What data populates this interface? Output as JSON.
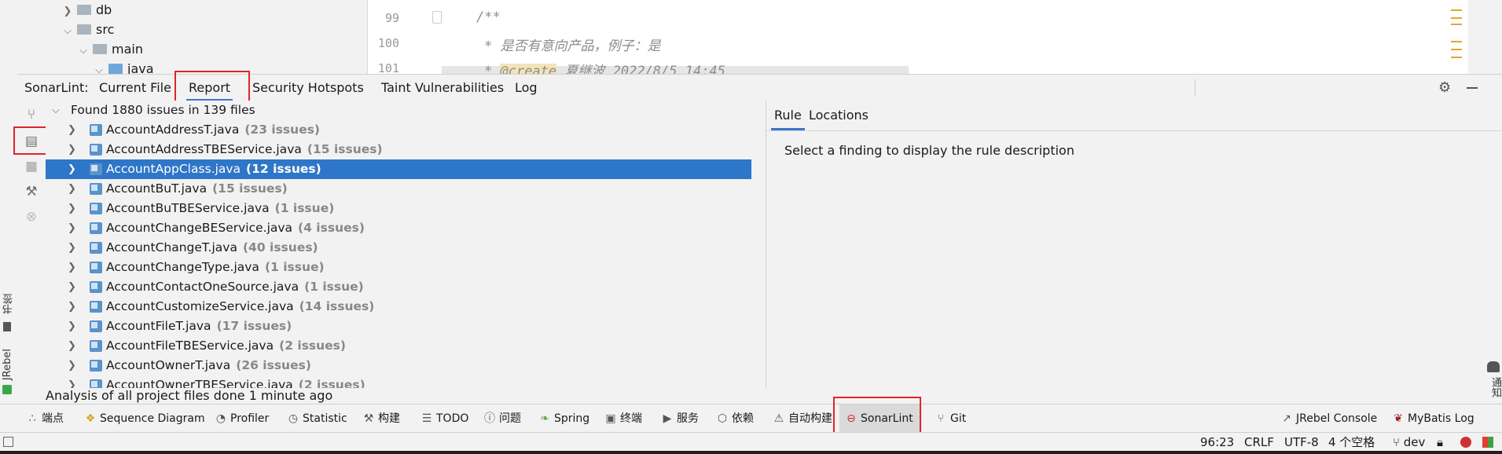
{
  "project_tree": [
    {
      "label": "db",
      "expanded": false
    },
    {
      "label": "src",
      "expanded": true
    },
    {
      "label": "main",
      "expanded": true
    },
    {
      "label": "java",
      "expanded": true
    }
  ],
  "editor": {
    "line_numbers": [
      "99",
      "100",
      "101"
    ],
    "lines": [
      "/**",
      "* 是否有意向产品，例子：是",
      "* @create 夏继波 2022/8/5 14:45"
    ],
    "tag_text": "@create"
  },
  "sonarlint": {
    "label": "SonarLint:",
    "tabs": [
      "Current File",
      "Report",
      "Security Hotspots",
      "Taint Vulnerabilities",
      "Log"
    ],
    "active_tab": "Report"
  },
  "report": {
    "root": "Found 1880 issues in 139 files",
    "files": [
      {
        "name": "AccountAddressT.java",
        "count": "(23 issues)"
      },
      {
        "name": "AccountAddressTBEService.java",
        "count": "(15 issues)"
      },
      {
        "name": "AccountAppClass.java",
        "count": "(12 issues)",
        "selected": true
      },
      {
        "name": "AccountBuT.java",
        "count": "(15 issues)"
      },
      {
        "name": "AccountBuTBEService.java",
        "count": "(1 issue)"
      },
      {
        "name": "AccountChangeBEService.java",
        "count": "(4 issues)"
      },
      {
        "name": "AccountChangeT.java",
        "count": "(40 issues)"
      },
      {
        "name": "AccountChangeType.java",
        "count": "(1 issue)"
      },
      {
        "name": "AccountContactOneSource.java",
        "count": "(1 issue)"
      },
      {
        "name": "AccountCustomizeService.java",
        "count": "(14 issues)"
      },
      {
        "name": "AccountFileT.java",
        "count": "(17 issues)"
      },
      {
        "name": "AccountFileTBEService.java",
        "count": "(2 issues)"
      },
      {
        "name": "AccountOwnerT.java",
        "count": "(26 issues)"
      },
      {
        "name": "AccountOwnerTBEService.java",
        "count": "(2 issues)"
      }
    ],
    "analysis_status": "Analysis of all project files done 1 minute ago"
  },
  "detail": {
    "tabs": [
      "Rule",
      "Locations"
    ],
    "message": "Select a finding to display the rule description"
  },
  "left_strip": {
    "bookmarks": "书签",
    "jrebel": "JRebel"
  },
  "right_strip": {
    "notifications": "通知"
  },
  "tool_windows": [
    "端点",
    "Sequence Diagram",
    "Profiler",
    "Statistic",
    "构建",
    "TODO",
    "问题",
    "Spring",
    "终端",
    "服务",
    "依赖",
    "自动构建",
    "SonarLint",
    "Git"
  ],
  "tool_windows_right": [
    "JRebel Console",
    "MyBatis Log"
  ],
  "active_tool_window": "SonarLint",
  "status_bar": {
    "position": "96:23",
    "line_sep": "CRLF",
    "encoding": "UTF-8",
    "indent": "4 个空格",
    "branch": "dev"
  },
  "colors": {
    "selection": "#2e76c8",
    "highlight_box": "#e0242e",
    "sonar_red": "#d03030"
  }
}
